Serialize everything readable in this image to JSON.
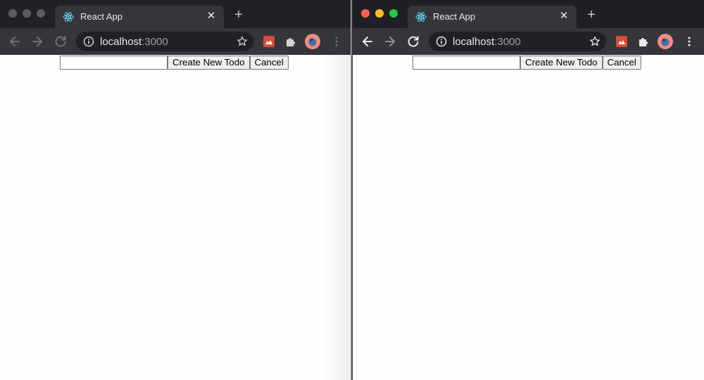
{
  "windows": [
    {
      "id": "left",
      "focused": false,
      "traffic_lights": [
        "#5b5c5e",
        "#5b5c5e",
        "#5b5c5e"
      ],
      "tab": {
        "title": "React App",
        "favicon": "react-logo-icon",
        "close_icon": "close-icon"
      },
      "new_tab_icon": "plus-icon",
      "address_bar": {
        "host": "localhost",
        "port": ":3000",
        "icon": "info-icon"
      },
      "form": {
        "input_value": "",
        "create_label": "Create New Todo",
        "cancel_label": "Cancel"
      }
    },
    {
      "id": "right",
      "focused": true,
      "traffic_lights": [
        "#fe5f57",
        "#febc2e",
        "#28c840"
      ],
      "tab": {
        "title": "React App",
        "favicon": "react-logo-icon",
        "close_icon": "close-icon"
      },
      "new_tab_icon": "plus-icon",
      "address_bar": {
        "host": "localhost",
        "port": ":3000",
        "icon": "info-icon"
      },
      "form": {
        "input_value": "",
        "create_label": "Create New Todo",
        "cancel_label": "Cancel"
      }
    }
  ],
  "colors": {
    "chrome_dark": "#202124",
    "toolbar": "#35363a",
    "react_blue": "#61dafb"
  }
}
